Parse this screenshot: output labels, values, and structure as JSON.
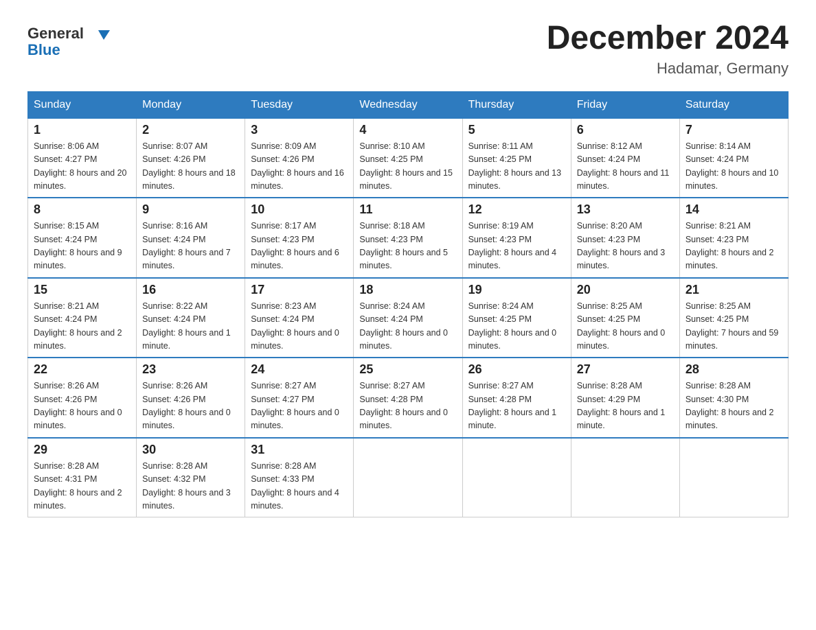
{
  "header": {
    "logo_general": "General",
    "logo_blue": "Blue",
    "month_title": "December 2024",
    "location": "Hadamar, Germany"
  },
  "days_of_week": [
    "Sunday",
    "Monday",
    "Tuesday",
    "Wednesday",
    "Thursday",
    "Friday",
    "Saturday"
  ],
  "weeks": [
    [
      {
        "day": 1,
        "sunrise": "Sunrise: 8:06 AM",
        "sunset": "Sunset: 4:27 PM",
        "daylight": "Daylight: 8 hours and 20 minutes."
      },
      {
        "day": 2,
        "sunrise": "Sunrise: 8:07 AM",
        "sunset": "Sunset: 4:26 PM",
        "daylight": "Daylight: 8 hours and 18 minutes."
      },
      {
        "day": 3,
        "sunrise": "Sunrise: 8:09 AM",
        "sunset": "Sunset: 4:26 PM",
        "daylight": "Daylight: 8 hours and 16 minutes."
      },
      {
        "day": 4,
        "sunrise": "Sunrise: 8:10 AM",
        "sunset": "Sunset: 4:25 PM",
        "daylight": "Daylight: 8 hours and 15 minutes."
      },
      {
        "day": 5,
        "sunrise": "Sunrise: 8:11 AM",
        "sunset": "Sunset: 4:25 PM",
        "daylight": "Daylight: 8 hours and 13 minutes."
      },
      {
        "day": 6,
        "sunrise": "Sunrise: 8:12 AM",
        "sunset": "Sunset: 4:24 PM",
        "daylight": "Daylight: 8 hours and 11 minutes."
      },
      {
        "day": 7,
        "sunrise": "Sunrise: 8:14 AM",
        "sunset": "Sunset: 4:24 PM",
        "daylight": "Daylight: 8 hours and 10 minutes."
      }
    ],
    [
      {
        "day": 8,
        "sunrise": "Sunrise: 8:15 AM",
        "sunset": "Sunset: 4:24 PM",
        "daylight": "Daylight: 8 hours and 9 minutes."
      },
      {
        "day": 9,
        "sunrise": "Sunrise: 8:16 AM",
        "sunset": "Sunset: 4:24 PM",
        "daylight": "Daylight: 8 hours and 7 minutes."
      },
      {
        "day": 10,
        "sunrise": "Sunrise: 8:17 AM",
        "sunset": "Sunset: 4:23 PM",
        "daylight": "Daylight: 8 hours and 6 minutes."
      },
      {
        "day": 11,
        "sunrise": "Sunrise: 8:18 AM",
        "sunset": "Sunset: 4:23 PM",
        "daylight": "Daylight: 8 hours and 5 minutes."
      },
      {
        "day": 12,
        "sunrise": "Sunrise: 8:19 AM",
        "sunset": "Sunset: 4:23 PM",
        "daylight": "Daylight: 8 hours and 4 minutes."
      },
      {
        "day": 13,
        "sunrise": "Sunrise: 8:20 AM",
        "sunset": "Sunset: 4:23 PM",
        "daylight": "Daylight: 8 hours and 3 minutes."
      },
      {
        "day": 14,
        "sunrise": "Sunrise: 8:21 AM",
        "sunset": "Sunset: 4:23 PM",
        "daylight": "Daylight: 8 hours and 2 minutes."
      }
    ],
    [
      {
        "day": 15,
        "sunrise": "Sunrise: 8:21 AM",
        "sunset": "Sunset: 4:24 PM",
        "daylight": "Daylight: 8 hours and 2 minutes."
      },
      {
        "day": 16,
        "sunrise": "Sunrise: 8:22 AM",
        "sunset": "Sunset: 4:24 PM",
        "daylight": "Daylight: 8 hours and 1 minute."
      },
      {
        "day": 17,
        "sunrise": "Sunrise: 8:23 AM",
        "sunset": "Sunset: 4:24 PM",
        "daylight": "Daylight: 8 hours and 0 minutes."
      },
      {
        "day": 18,
        "sunrise": "Sunrise: 8:24 AM",
        "sunset": "Sunset: 4:24 PM",
        "daylight": "Daylight: 8 hours and 0 minutes."
      },
      {
        "day": 19,
        "sunrise": "Sunrise: 8:24 AM",
        "sunset": "Sunset: 4:25 PM",
        "daylight": "Daylight: 8 hours and 0 minutes."
      },
      {
        "day": 20,
        "sunrise": "Sunrise: 8:25 AM",
        "sunset": "Sunset: 4:25 PM",
        "daylight": "Daylight: 8 hours and 0 minutes."
      },
      {
        "day": 21,
        "sunrise": "Sunrise: 8:25 AM",
        "sunset": "Sunset: 4:25 PM",
        "daylight": "Daylight: 7 hours and 59 minutes."
      }
    ],
    [
      {
        "day": 22,
        "sunrise": "Sunrise: 8:26 AM",
        "sunset": "Sunset: 4:26 PM",
        "daylight": "Daylight: 8 hours and 0 minutes."
      },
      {
        "day": 23,
        "sunrise": "Sunrise: 8:26 AM",
        "sunset": "Sunset: 4:26 PM",
        "daylight": "Daylight: 8 hours and 0 minutes."
      },
      {
        "day": 24,
        "sunrise": "Sunrise: 8:27 AM",
        "sunset": "Sunset: 4:27 PM",
        "daylight": "Daylight: 8 hours and 0 minutes."
      },
      {
        "day": 25,
        "sunrise": "Sunrise: 8:27 AM",
        "sunset": "Sunset: 4:28 PM",
        "daylight": "Daylight: 8 hours and 0 minutes."
      },
      {
        "day": 26,
        "sunrise": "Sunrise: 8:27 AM",
        "sunset": "Sunset: 4:28 PM",
        "daylight": "Daylight: 8 hours and 1 minute."
      },
      {
        "day": 27,
        "sunrise": "Sunrise: 8:28 AM",
        "sunset": "Sunset: 4:29 PM",
        "daylight": "Daylight: 8 hours and 1 minute."
      },
      {
        "day": 28,
        "sunrise": "Sunrise: 8:28 AM",
        "sunset": "Sunset: 4:30 PM",
        "daylight": "Daylight: 8 hours and 2 minutes."
      }
    ],
    [
      {
        "day": 29,
        "sunrise": "Sunrise: 8:28 AM",
        "sunset": "Sunset: 4:31 PM",
        "daylight": "Daylight: 8 hours and 2 minutes."
      },
      {
        "day": 30,
        "sunrise": "Sunrise: 8:28 AM",
        "sunset": "Sunset: 4:32 PM",
        "daylight": "Daylight: 8 hours and 3 minutes."
      },
      {
        "day": 31,
        "sunrise": "Sunrise: 8:28 AM",
        "sunset": "Sunset: 4:33 PM",
        "daylight": "Daylight: 8 hours and 4 minutes."
      },
      null,
      null,
      null,
      null
    ]
  ]
}
